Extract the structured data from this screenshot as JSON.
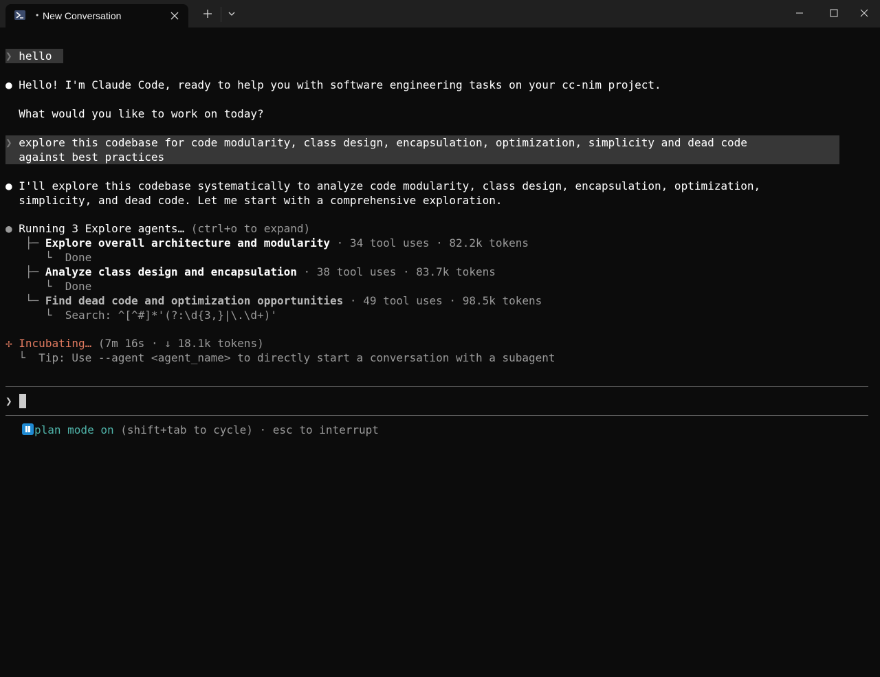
{
  "tab": {
    "indicator": "•",
    "title": "New Conversation"
  },
  "conversation": {
    "user1": {
      "caret": "❯",
      "text": "hello"
    },
    "assistant1": {
      "bullet": "●",
      "line1": "Hello! I'm Claude Code, ready to help you with software engineering tasks on your cc-nim project.",
      "line2": "What would you like to work on today?"
    },
    "user2": {
      "caret": "❯",
      "line1": "explore this codebase for code modularity, class design, encapsulation, optimization, simplicity and dead code",
      "line2": "against best practices"
    },
    "assistant2": {
      "bullet": "●",
      "line1": "I'll explore this codebase systematically to analyze code modularity, class design, encapsulation, optimization,",
      "line2": "simplicity, and dead code. Let me start with a comprehensive exploration."
    },
    "agents": {
      "bullet": "●",
      "title": "Running 3 Explore agents…",
      "hint": " (ctrl+o to expand)",
      "items": [
        {
          "branch": "├─",
          "name": "Explore overall architecture and modularity",
          "stats": " · 34 tool uses · 82.2k tokens",
          "sub_glyph": "└",
          "sub_text": "Done"
        },
        {
          "branch": "├─",
          "name": "Analyze class design and encapsulation",
          "stats": " · 38 tool uses · 83.7k tokens",
          "sub_glyph": "└",
          "sub_text": "Done"
        },
        {
          "branch": "└─",
          "name": "Find dead code and optimization opportunities",
          "stats": " · 49 tool uses · 98.5k tokens",
          "sub_glyph": "└",
          "sub_text": "Search: ^[^#]*'(?:\\d{3,}|\\.\\d+)'"
        }
      ]
    },
    "status": {
      "spinner": "✢",
      "label": "Incubating…",
      "meta": " (7m 16s · ↓ 18.1k tokens)",
      "tip_glyph": "└",
      "tip": "Tip: Use --agent <agent_name> to directly start a conversation with a subagent"
    }
  },
  "input": {
    "caret": "❯",
    "value": ""
  },
  "footer": {
    "mode": "plan mode on",
    "cycle": " (shift+tab to cycle)",
    "interrupt": " · esc to interrupt"
  },
  "colors": {
    "background": "#0c0c0c",
    "accent_orange": "#e07a5f",
    "accent_teal": "#4fb3a9",
    "pause_icon": "#1f8ad2"
  }
}
